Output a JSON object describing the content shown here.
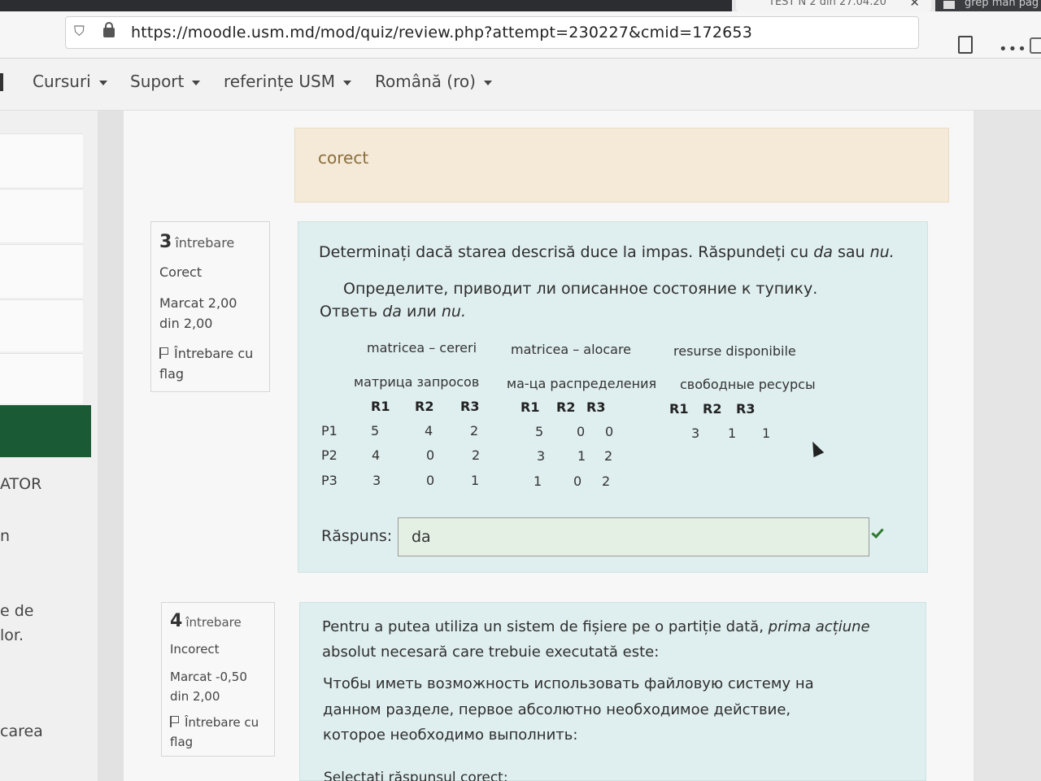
{
  "browser": {
    "active_tab_title": "TEST N 2 din 27.04.20",
    "second_tab_title": "grep man pag",
    "url": "https://moodle.usm.md/mod/quiz/review.php?attempt=230227&cmid=172653"
  },
  "nav": {
    "items": [
      "Cursuri",
      "Suport",
      "referințe USM",
      "Română (ro)"
    ]
  },
  "sidebar": {
    "visible_fragments": [
      "ATOR",
      "n",
      "e de",
      "lor.",
      "carea"
    ]
  },
  "previous_feedback": "corect",
  "question3": {
    "number": "3",
    "word": "întrebare",
    "state": "Corect",
    "marks_line1": "Marcat 2,00",
    "marks_line2": "din 2,00",
    "flag_line1": "Întrebare cu",
    "flag_line2": "flag",
    "text_ro_prefix": "Determinați dacă starea descrisă duce la impas. Răspundeți cu ",
    "text_ro_da": "da",
    "text_ro_mid": " sau ",
    "text_ro_nu": "nu.",
    "text_ru_line1": "Определите, приводит ли описанное состояние к тупику.",
    "text_ru_prefix": "Ответь ",
    "text_ru_da": "da",
    "text_ru_mid": " или ",
    "text_ru_nu": "nu.",
    "headers_ro": [
      "matricea – cereri",
      "matricea – alocare",
      "resurse disponibile"
    ],
    "headers_ru": [
      "матрица запросов",
      "ма-ца распределения",
      "свободные ресурсы"
    ],
    "columns": [
      "R1",
      "R2",
      "R3"
    ],
    "rows": [
      {
        "label": "P1",
        "request": [
          "5",
          "4",
          "2"
        ],
        "allocation": [
          "5",
          "0",
          "0"
        ]
      },
      {
        "label": "P2",
        "request": [
          "4",
          "0",
          "2"
        ],
        "allocation": [
          "3",
          "1",
          "2"
        ]
      },
      {
        "label": "P3",
        "request": [
          "3",
          "0",
          "1"
        ],
        "allocation": [
          "1",
          "0",
          "2"
        ]
      }
    ],
    "available": [
      "3",
      "1",
      "1"
    ],
    "answer_label": "Răspuns:",
    "answer_value": "da"
  },
  "question4": {
    "number": "4",
    "word": "întrebare",
    "state": "Incorect",
    "marks_line1": "Marcat -0,50",
    "marks_line2": "din 2,00",
    "flag_line1": "Întrebare cu",
    "flag_line2": "flag",
    "text_ro_line1_prefix": "Pentru a putea utiliza un sistem de fișiere pe o partiție dată, ",
    "text_ro_line1_italic": "prima acțiune",
    "text_ro_line2": "absolut necesară care trebuie executată este:",
    "text_ru_line1": "Чтобы иметь возможность использовать файловую систему на",
    "text_ru_line2": "данном разделе, первое абсолютно необходимое действие,",
    "text_ru_line3": "которое необходимо выполнить:",
    "select_prompt": "Selectați răspunsul corect:"
  }
}
